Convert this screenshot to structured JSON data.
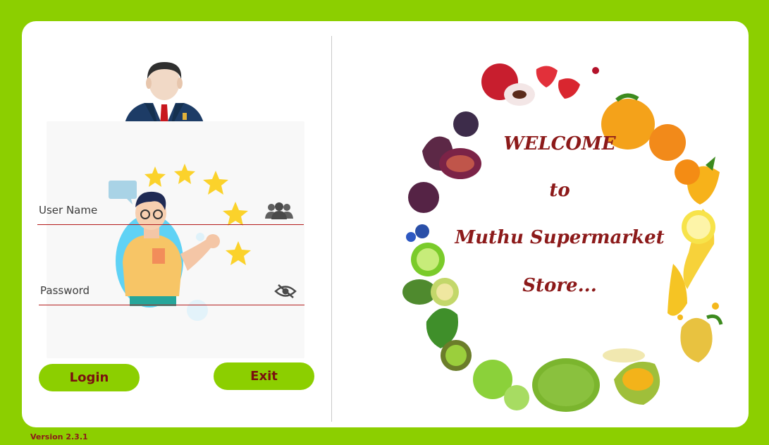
{
  "login": {
    "username_label": "User Name",
    "password_label": "Password",
    "login_button": "Login",
    "exit_button": "Exit"
  },
  "welcome": {
    "line1": "WELCOME",
    "line2": "to",
    "line3": "Muthu Supermarket",
    "line4": "Store..."
  },
  "footer": {
    "version": "Version 2.3.1"
  },
  "icons": {
    "avatar": "businessman-avatar-icon",
    "username": "users-group-icon",
    "password": "eye-slash-icon"
  },
  "colors": {
    "frame": "#8ccf00",
    "button": "#8ccf00",
    "button_text": "#7a1010",
    "welcome_text": "#8c1a1a",
    "field_underline": "#b31b1b"
  }
}
